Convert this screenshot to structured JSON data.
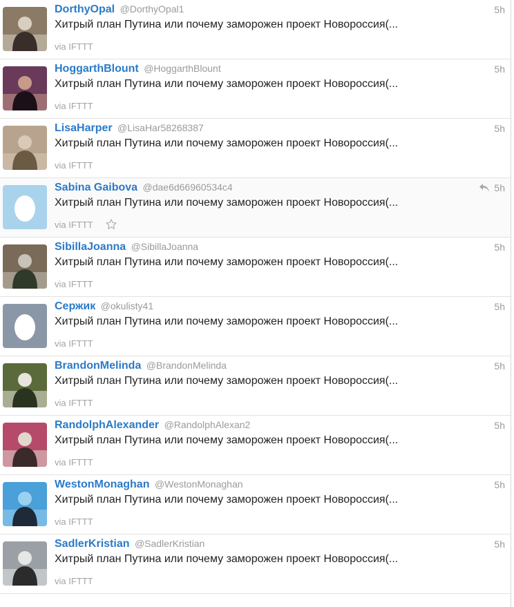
{
  "tweets": [
    {
      "name": "DorthyOpal",
      "handle": "@DorthyOpal1",
      "time": "5h",
      "text": "Хитрый план Путина или почему заморожен проект Новороссия(...",
      "source": "via IFTTT",
      "avatar": "photo",
      "colors": [
        "#8a7a66",
        "#3a2e2a",
        "#d9cfc1"
      ]
    },
    {
      "name": "HoggarthBlount",
      "handle": "@HoggarthBlount",
      "time": "5h",
      "text": "Хитрый план Путина или почему заморожен проект Новороссия(...",
      "source": "via IFTTT",
      "avatar": "photo",
      "colors": [
        "#6a3a5a",
        "#1c1018",
        "#c79a8a"
      ]
    },
    {
      "name": "LisaHarper",
      "handle": "@LisaHar58268387",
      "time": "5h",
      "text": "Хитрый план Путина или почему заморожен проект Новороссия(...",
      "source": "via IFTTT",
      "avatar": "photo",
      "colors": [
        "#b8a48e",
        "#6b5a44",
        "#d9c9b6"
      ]
    },
    {
      "name": "Sabina Gaibova",
      "handle": "@dae6d66960534c4",
      "time": "5h",
      "text": "Хитрый план Путина или почему заморожен проект Новороссия(...",
      "source": "via IFTTT",
      "avatar": "egg",
      "colors": [
        "#a9d3ec",
        "#ffffff",
        "#a9d3ec"
      ]
    },
    {
      "name": "SibillaJoanna",
      "handle": "@SibillaJoanna",
      "time": "5h",
      "text": "Хитрый план Путина или почему заморожен проект Новороссия(...",
      "source": "via IFTTT",
      "avatar": "photo",
      "colors": [
        "#7a6a58",
        "#2f3a2a",
        "#c9c2b8"
      ]
    },
    {
      "name": "Сержик",
      "handle": "@okulisty41",
      "time": "5h",
      "text": "Хитрый план Путина или почему заморожен проект Новороссия(...",
      "source": "via IFTTT",
      "avatar": "egg",
      "colors": [
        "#8a97a6",
        "#ffffff",
        "#8a97a6"
      ]
    },
    {
      "name": "BrandonMelinda",
      "handle": "@BrandonMelinda",
      "time": "5h",
      "text": "Хитрый план Путина или почему заморожен проект Новороссия(...",
      "source": "via IFTTT",
      "avatar": "photo",
      "colors": [
        "#5b6a3a",
        "#2a3320",
        "#e8e4dc"
      ]
    },
    {
      "name": "RandolphAlexander",
      "handle": "@RandolphAlexan2",
      "time": "5h",
      "text": "Хитрый план Путина или почему заморожен проект Новороссия(...",
      "source": "via IFTTT",
      "avatar": "photo",
      "colors": [
        "#b64a6a",
        "#3a2a2a",
        "#e0d8cc"
      ]
    },
    {
      "name": "WestonMonaghan",
      "handle": "@WestonMonaghan",
      "time": "5h",
      "text": "Хитрый план Путина или почему заморожен проект Новороссия(...",
      "source": "via IFTTT",
      "avatar": "photo",
      "colors": [
        "#4aa0d8",
        "#1f2a38",
        "#9ad0f0"
      ]
    },
    {
      "name": "SadlerKristian",
      "handle": "@SadlerKristian",
      "time": "5h",
      "text": "Хитрый план Путина или почему заморожен проект Новороссия(...",
      "source": "via IFTTT",
      "avatar": "photo",
      "colors": [
        "#9aa0a6",
        "#2b2b2b",
        "#e6e6e6"
      ]
    }
  ]
}
